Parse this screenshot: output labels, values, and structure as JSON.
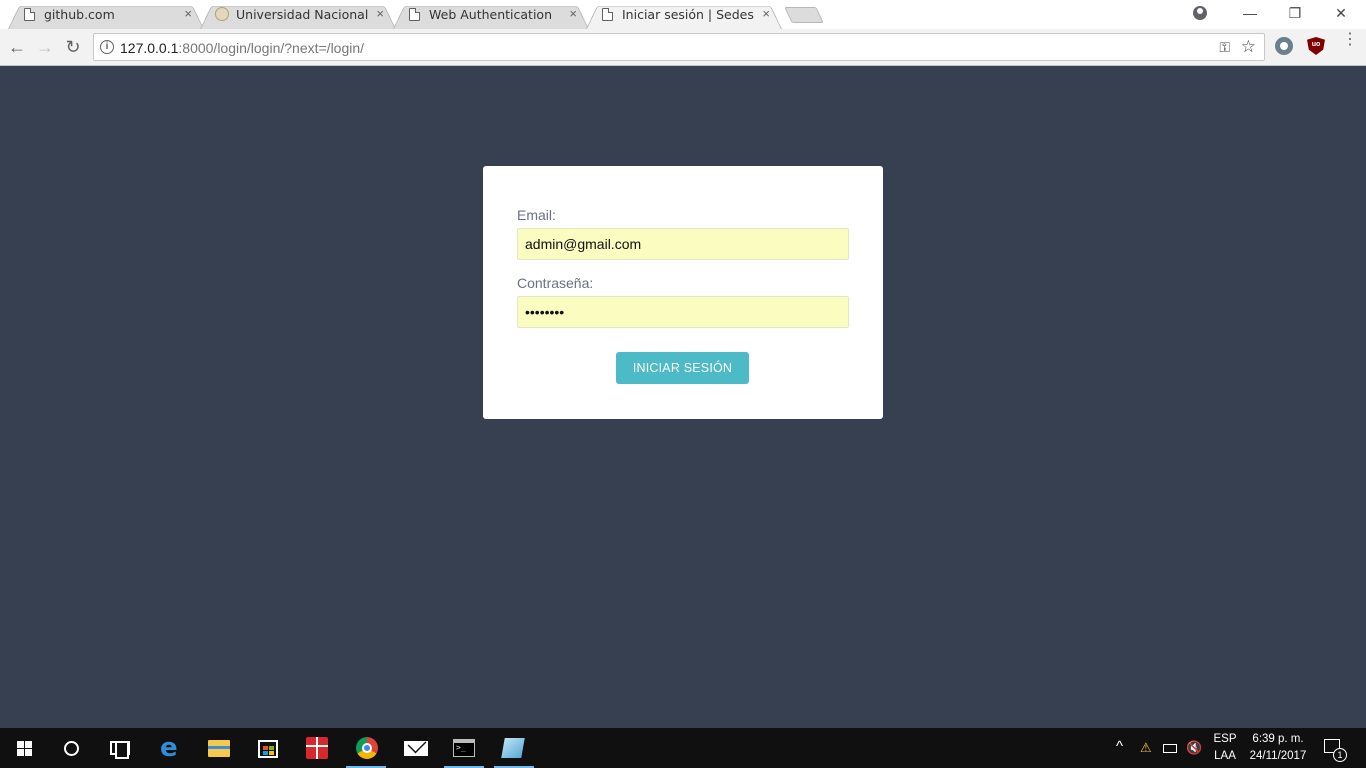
{
  "browser": {
    "tabs": [
      {
        "title": "github.com",
        "close": "×"
      },
      {
        "title": "Universidad Nacional Ma",
        "close": "×"
      },
      {
        "title": "Web Authentication",
        "close": "×"
      },
      {
        "title": "Iniciar sesión | Sedes",
        "close": "×",
        "active": true
      }
    ],
    "window_controls": {
      "minimize": "—",
      "restore": "❐",
      "close": "✕"
    },
    "address": {
      "host": "127.0.0.1",
      "rest": ":8000/login/login/?next=/login/"
    },
    "nav": {
      "back": "←",
      "forward": "→",
      "reload": "↻"
    },
    "omnibox_icons": {
      "info": "i",
      "key": "⚿",
      "star": "☆"
    },
    "extensions": {
      "ublock_label": "uo"
    },
    "menu": "⋮"
  },
  "login": {
    "email_label": "Email:",
    "email_value": "admin@gmail.com",
    "password_label": "Contraseña:",
    "password_value": "pass1234",
    "submit_label": "INICIAR SESIÓN"
  },
  "taskbar": {
    "lang_top": "ESP",
    "lang_bottom": "LAA",
    "time": "6:39 p. m.",
    "date": "24/11/2017",
    "notification_count": "1",
    "tray": {
      "chevron": "^",
      "volume": "🔇"
    }
  },
  "colors": {
    "page_background": "#374051",
    "card_background": "#ffffff",
    "button_accent": "#4dbbc7",
    "autofill_field": "#fafcc0"
  }
}
